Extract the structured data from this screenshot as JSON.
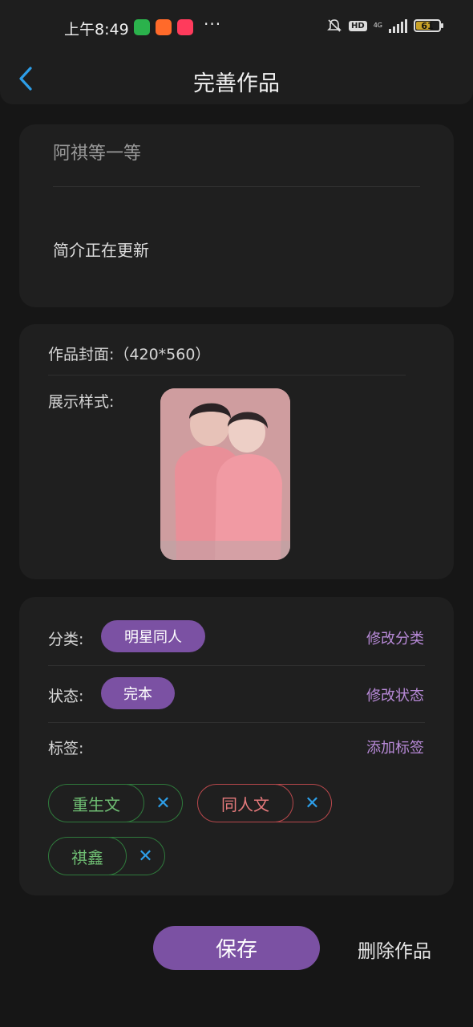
{
  "status_bar": {
    "time": "上午8:49",
    "apps": [
      "wechat-icon",
      "taobao-icon",
      "app-icon"
    ],
    "more": "···",
    "hd": "HD",
    "network": "4G",
    "battery": "61"
  },
  "header": {
    "back_icon": "chevron-left-icon",
    "title": "完善作品"
  },
  "work_info": {
    "title_value": "阿祺等一等",
    "intro_value": "简介正在更新"
  },
  "cover": {
    "label": "作品封面:（420*560）",
    "preview_label": "展示样式:"
  },
  "meta": {
    "category_label": "分类:",
    "category_value": "明星同人",
    "category_action": "修改分类",
    "status_label": "状态:",
    "status_value": "完本",
    "status_action": "修改状态",
    "tags_label": "标签:",
    "tags_action": "添加标签",
    "tags": [
      {
        "label": "重生文",
        "color": "green"
      },
      {
        "label": "同人文",
        "color": "red"
      },
      {
        "label": "祺鑫",
        "color": "green"
      }
    ],
    "remove_icon": "✕"
  },
  "actions": {
    "save_label": "保存",
    "delete_label": "删除作品"
  },
  "colors": {
    "accent": "#7b51a3",
    "link": "#b88ad8",
    "back_icon": "#2d9ee8",
    "tag_green": "#6fbe73",
    "tag_red": "#e77a7c",
    "remove_icon": "#2d9ee8"
  }
}
